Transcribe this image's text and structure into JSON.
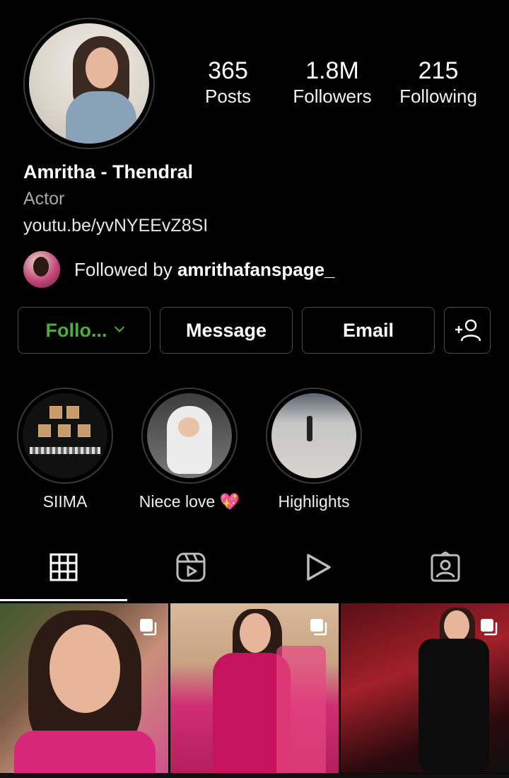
{
  "profile": {
    "name": "Amritha - Thendral",
    "category": "Actor",
    "link": "youtu.be/yvNYEEvZ8SI",
    "followed_by_prefix": "Followed by ",
    "followed_by_user": "amrithafanspage_"
  },
  "stats": {
    "posts": {
      "value": "365",
      "label": "Posts"
    },
    "followers": {
      "value": "1.8M",
      "label": "Followers"
    },
    "following": {
      "value": "215",
      "label": "Following"
    }
  },
  "buttons": {
    "follow": "Follo...",
    "message": "Message",
    "email": "Email"
  },
  "highlights": [
    {
      "label": "SIIMA"
    },
    {
      "label": "Niece love 💖"
    },
    {
      "label": "Highlights"
    }
  ],
  "tabs": [
    {
      "icon": "grid-icon",
      "active": true
    },
    {
      "icon": "reels-icon",
      "active": false
    },
    {
      "icon": "play-icon",
      "active": false
    },
    {
      "icon": "tagged-icon",
      "active": false
    }
  ],
  "colors": {
    "background": "#000000",
    "follow_green": "#4caf39",
    "secondary_text": "#a8a8a8",
    "border": "#4a4a4a"
  }
}
